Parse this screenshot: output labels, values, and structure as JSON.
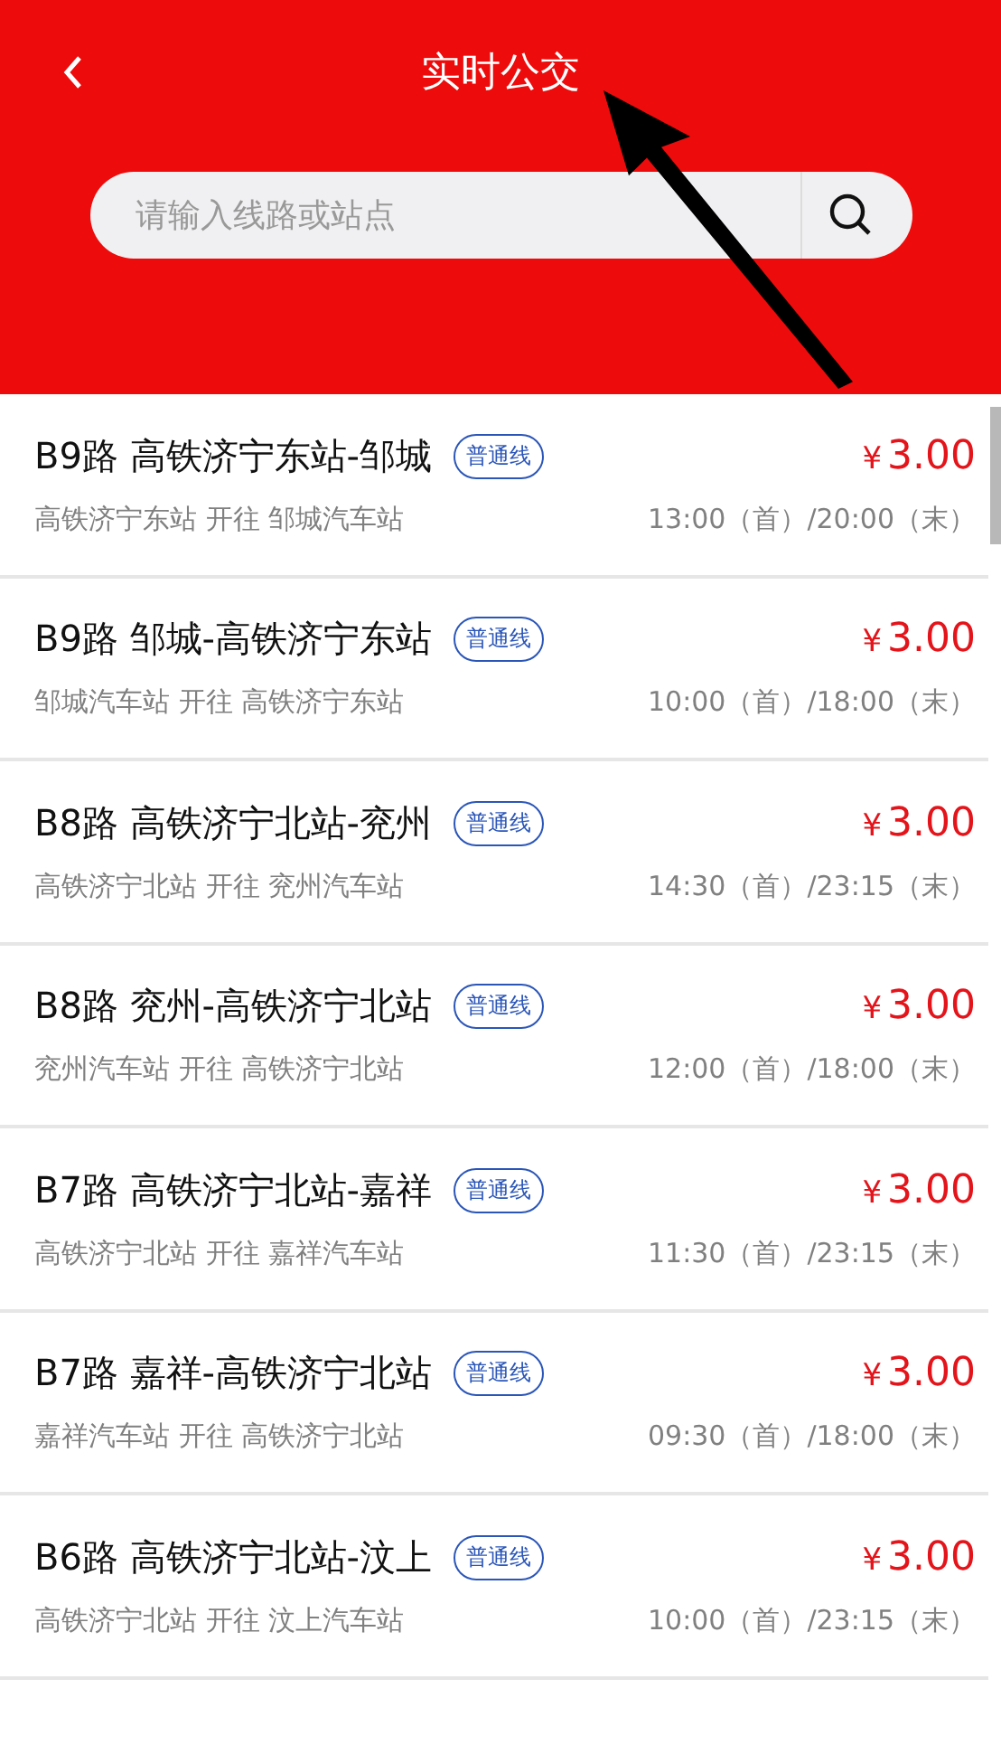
{
  "header": {
    "title": "实时公交",
    "search": {
      "placeholder": "请输入线路或站点"
    }
  },
  "routes": [
    {
      "name": "B9路 高铁济宁东站-邹城",
      "tag": "普通线",
      "price_symbol": "¥",
      "price": "3.00",
      "direction": "高铁济宁东站 开往 邹城汽车站",
      "hours": "13:00（首）/20:00（末）"
    },
    {
      "name": "B9路 邹城-高铁济宁东站",
      "tag": "普通线",
      "price_symbol": "¥",
      "price": "3.00",
      "direction": "邹城汽车站 开往 高铁济宁东站",
      "hours": "10:00（首）/18:00（末）"
    },
    {
      "name": "B8路 高铁济宁北站-兖州",
      "tag": "普通线",
      "price_symbol": "¥",
      "price": "3.00",
      "direction": "高铁济宁北站 开往 兖州汽车站",
      "hours": "14:30（首）/23:15（末）"
    },
    {
      "name": "B8路 兖州-高铁济宁北站",
      "tag": "普通线",
      "price_symbol": "¥",
      "price": "3.00",
      "direction": "兖州汽车站 开往 高铁济宁北站",
      "hours": "12:00（首）/18:00（末）"
    },
    {
      "name": "B7路 高铁济宁北站-嘉祥",
      "tag": "普通线",
      "price_symbol": "¥",
      "price": "3.00",
      "direction": "高铁济宁北站 开往 嘉祥汽车站",
      "hours": "11:30（首）/23:15（末）"
    },
    {
      "name": "B7路 嘉祥-高铁济宁北站",
      "tag": "普通线",
      "price_symbol": "¥",
      "price": "3.00",
      "direction": "嘉祥汽车站 开往 高铁济宁北站",
      "hours": "09:30（首）/18:00（末）"
    },
    {
      "name": "B6路 高铁济宁北站-汶上",
      "tag": "普通线",
      "price_symbol": "¥",
      "price": "3.00",
      "direction": "高铁济宁北站 开往 汶上汽车站",
      "hours": "10:00（首）/23:15（末）"
    }
  ]
}
